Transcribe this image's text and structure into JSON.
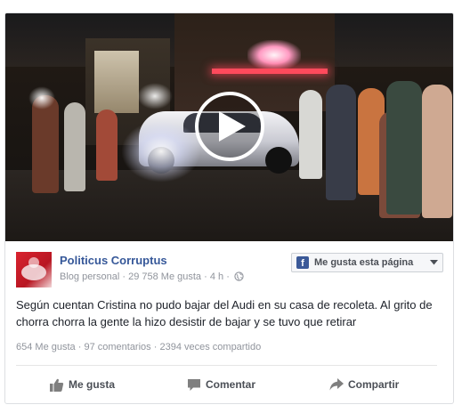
{
  "post": {
    "page_name": "Politicus Corruptus",
    "category": "Blog personal",
    "likes_count": "29 758 Me gusta",
    "time": "4 h",
    "separator": "·",
    "like_page_label": "Me gusta esta página",
    "text": "Según cuentan Cristina no pudo bajar del Audi en su casa de recoleta. Al grito de chorra chorra la gente la hizo desistir de bajar y se tuvo que retirar",
    "stats": {
      "likes": "654 Me gusta",
      "comments": "97 comentarios",
      "shares": "2394 veces compartido"
    },
    "actions": {
      "like": "Me gusta",
      "comment": "Comentar",
      "share": "Compartir"
    }
  },
  "icons": {
    "play": "play-icon",
    "globe": "globe-icon",
    "facebook": "facebook-icon",
    "caret": "chevron-down-icon",
    "thumb": "thumbs-up-icon",
    "comment": "comment-icon",
    "share": "share-arrow-icon"
  },
  "colors": {
    "link": "#365899",
    "meta": "#90949c",
    "facebook_blue": "#3b5998",
    "action_text": "#4b4f56"
  }
}
